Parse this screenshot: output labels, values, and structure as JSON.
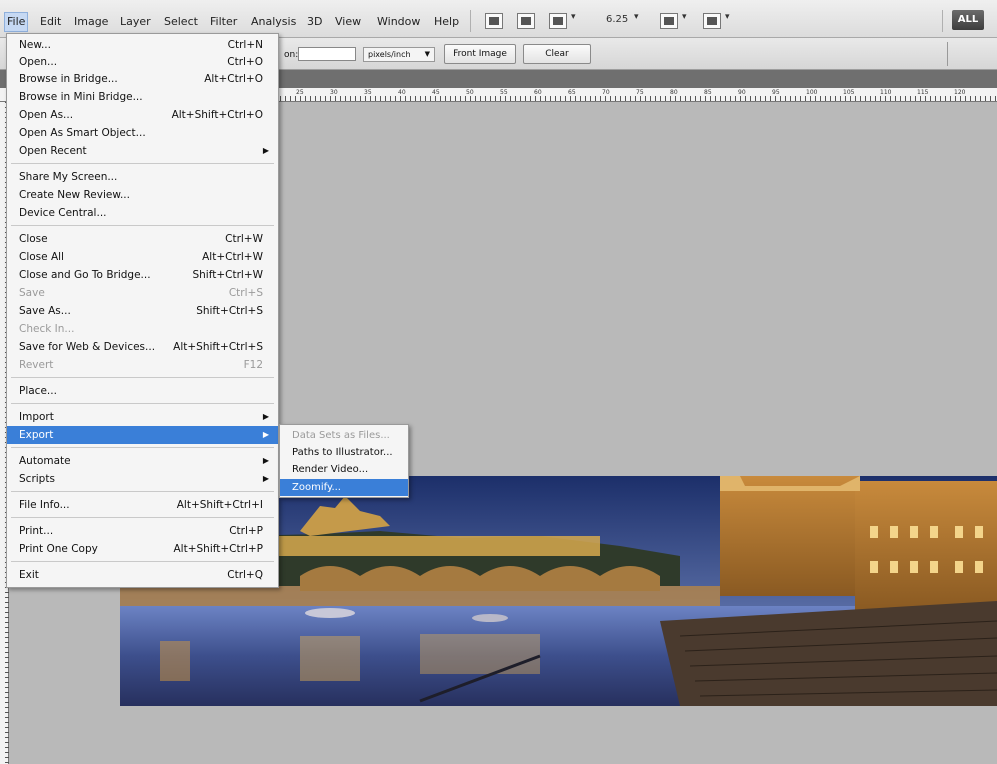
{
  "menubar": {
    "items": [
      "File",
      "Edit",
      "Image",
      "Layer",
      "Select",
      "Filter",
      "Analysis",
      "3D",
      "View",
      "Window",
      "Help"
    ],
    "zoom": "6.25",
    "all_label": "ALL"
  },
  "options": {
    "resolution_label": "on:",
    "resolution_value": "",
    "unit_select": "pixels/inch",
    "front_image": "Front Image",
    "clear": "Clear"
  },
  "ruler": {
    "labels": [
      "25",
      "30",
      "35",
      "40",
      "45",
      "50",
      "55",
      "60",
      "65",
      "70",
      "75",
      "80",
      "85",
      "90",
      "95",
      "100",
      "105",
      "110",
      "115",
      "120"
    ]
  },
  "file_menu": {
    "items": [
      {
        "label": "New...",
        "shortcut": "Ctrl+N"
      },
      {
        "label": "Open...",
        "shortcut": "Ctrl+O"
      },
      {
        "label": "Browse in Bridge...",
        "shortcut": "Alt+Ctrl+O"
      },
      {
        "label": "Browse in Mini Bridge...",
        "shortcut": ""
      },
      {
        "label": "Open As...",
        "shortcut": "Alt+Shift+Ctrl+O"
      },
      {
        "label": "Open As Smart Object...",
        "shortcut": ""
      },
      {
        "label": "Open Recent",
        "shortcut": ""
      },
      {
        "label": "Share My Screen...",
        "shortcut": ""
      },
      {
        "label": "Create New Review...",
        "shortcut": ""
      },
      {
        "label": "Device Central...",
        "shortcut": ""
      },
      {
        "label": "Close",
        "shortcut": "Ctrl+W"
      },
      {
        "label": "Close All",
        "shortcut": "Alt+Ctrl+W"
      },
      {
        "label": "Close and Go To Bridge...",
        "shortcut": "Shift+Ctrl+W"
      },
      {
        "label": "Save",
        "shortcut": "Ctrl+S"
      },
      {
        "label": "Save As...",
        "shortcut": "Shift+Ctrl+S"
      },
      {
        "label": "Check In...",
        "shortcut": ""
      },
      {
        "label": "Save for Web & Devices...",
        "shortcut": "Alt+Shift+Ctrl+S"
      },
      {
        "label": "Revert",
        "shortcut": "F12"
      },
      {
        "label": "Place...",
        "shortcut": ""
      },
      {
        "label": "Import",
        "shortcut": ""
      },
      {
        "label": "Export",
        "shortcut": ""
      },
      {
        "label": "Automate",
        "shortcut": ""
      },
      {
        "label": "Scripts",
        "shortcut": ""
      },
      {
        "label": "File Info...",
        "shortcut": "Alt+Shift+Ctrl+I"
      },
      {
        "label": "Print...",
        "shortcut": "Ctrl+P"
      },
      {
        "label": "Print One Copy",
        "shortcut": "Alt+Shift+Ctrl+P"
      },
      {
        "label": "Exit",
        "shortcut": "Ctrl+Q"
      }
    ]
  },
  "export_submenu": {
    "items": [
      {
        "label": "Data Sets as Files..."
      },
      {
        "label": "Paths to Illustrator..."
      },
      {
        "label": "Render Video..."
      },
      {
        "label": "Zoomify..."
      }
    ]
  }
}
